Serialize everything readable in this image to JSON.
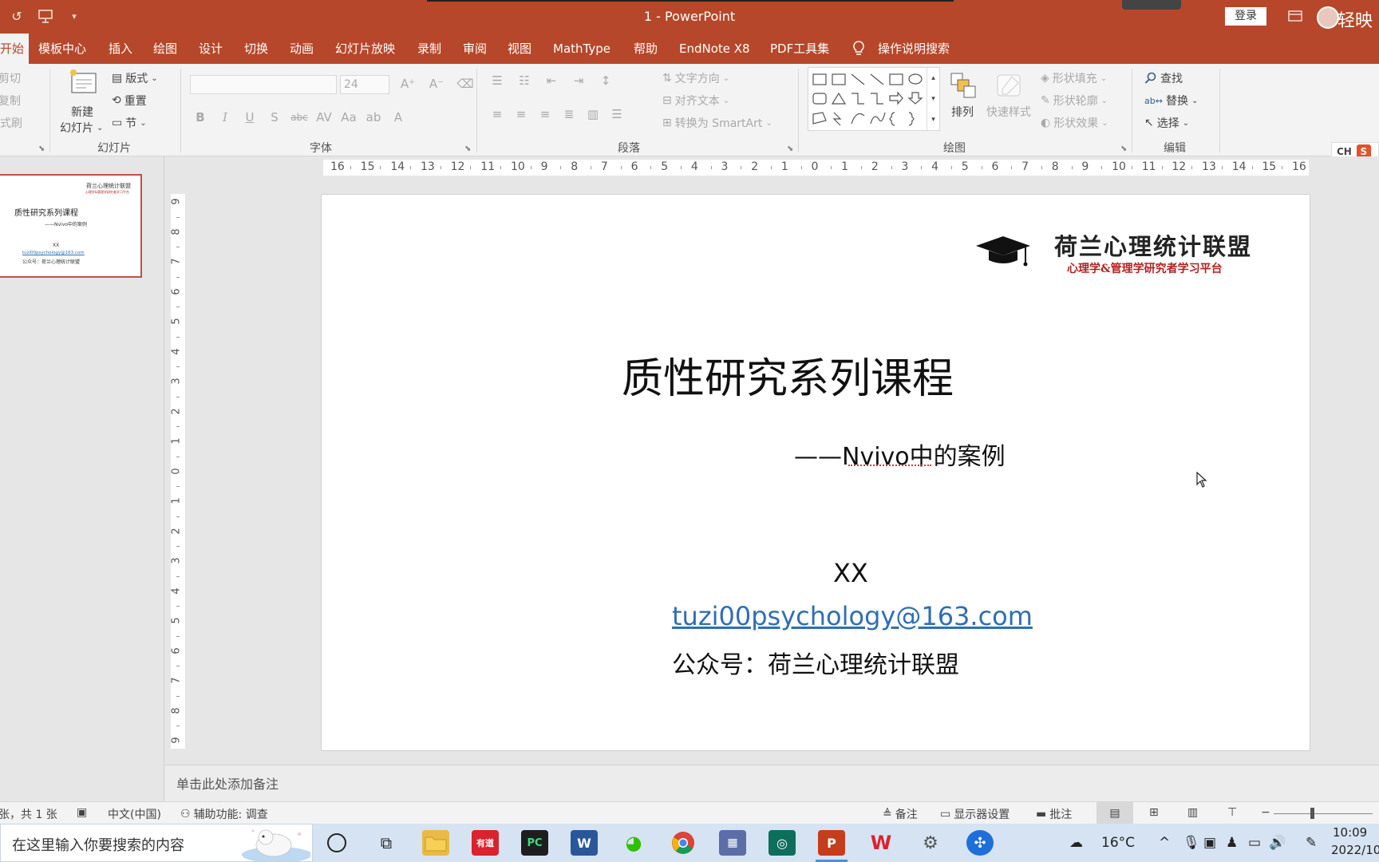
{
  "window": {
    "title": "1  -  PowerPoint",
    "login": "登录",
    "brand": "轻映"
  },
  "tabs": [
    "开始",
    "模板中心",
    "插入",
    "绘图",
    "设计",
    "切换",
    "动画",
    "幻灯片放映",
    "录制",
    "审阅",
    "视图",
    "MathType",
    "帮助",
    "EndNote X8",
    "PDF工具集"
  ],
  "tell_me": "操作说明搜索",
  "ribbon": {
    "clipboard": {
      "cut": "剪切",
      "copy": "复制",
      "painter": "格式刷"
    },
    "slides": {
      "new_slide_1": "新建",
      "new_slide_2": "幻灯片",
      "layout": "版式",
      "reset": "重置",
      "section": "节",
      "group": "幻灯片"
    },
    "font": {
      "name": "",
      "size": "24",
      "group": "字体"
    },
    "paragraph": {
      "text_direction": "文字方向",
      "align_text": "对齐文本",
      "smartart": "转换为 SmartArt",
      "group": "段落"
    },
    "drawing": {
      "arrange": "排列",
      "quick_styles": "快速样式",
      "fill": "形状填充",
      "outline": "形状轮廓",
      "effects": "形状效果",
      "group": "绘图"
    },
    "editing": {
      "find": "查找",
      "replace": "替换",
      "select": "选择",
      "group": "编辑"
    },
    "ime": "CH"
  },
  "thumbnail": {
    "logo": "荷兰心理统计联盟",
    "logo_sub": "心理学&管理学研究者学习平台",
    "title": "质性研究系列课程",
    "subtitle": "——Nvivo中的案例",
    "name": "XX",
    "email": "tuzi00psychology@163.com",
    "account": "公众号：荷兰心理统计联盟"
  },
  "ruler": {
    "h": [
      "16",
      "15",
      "14",
      "13",
      "12",
      "11",
      "10",
      "9",
      "8",
      "7",
      "6",
      "5",
      "4",
      "3",
      "2",
      "1",
      "0",
      "1",
      "2",
      "3",
      "4",
      "5",
      "6",
      "7",
      "8",
      "9",
      "10",
      "11",
      "12",
      "13",
      "14",
      "15",
      "16"
    ],
    "v": [
      "9",
      "8",
      "7",
      "6",
      "5",
      "4",
      "3",
      "2",
      "1",
      "0",
      "1",
      "2",
      "3",
      "4",
      "5",
      "6",
      "7",
      "8",
      "9"
    ]
  },
  "slide": {
    "logo_title": "荷兰心理统计联盟",
    "logo_sub": "心理学&管理学研究者学习平台",
    "title": "质性研究系列课程",
    "subtitle": "——Nvivo中的案例",
    "name": "XX",
    "email": "tuzi00psychology@163.com",
    "account": "公众号：荷兰心理统计联盟"
  },
  "notes_placeholder": "单击此处添加备注",
  "status": {
    "slide_count": "张，共 1 张",
    "language": "中文(中国)",
    "accessibility": "辅助功能: 调查",
    "notes": "备注",
    "display": "显示器设置",
    "comments": "批注"
  },
  "taskbar": {
    "search_placeholder": "在这里输入你要搜索的内容",
    "temperature": "16°C",
    "time": "10:09",
    "date": "2022/10"
  },
  "colors": {
    "accent": "#b7472a",
    "link": "#2f6eb5",
    "logo_red": "#b22222"
  }
}
